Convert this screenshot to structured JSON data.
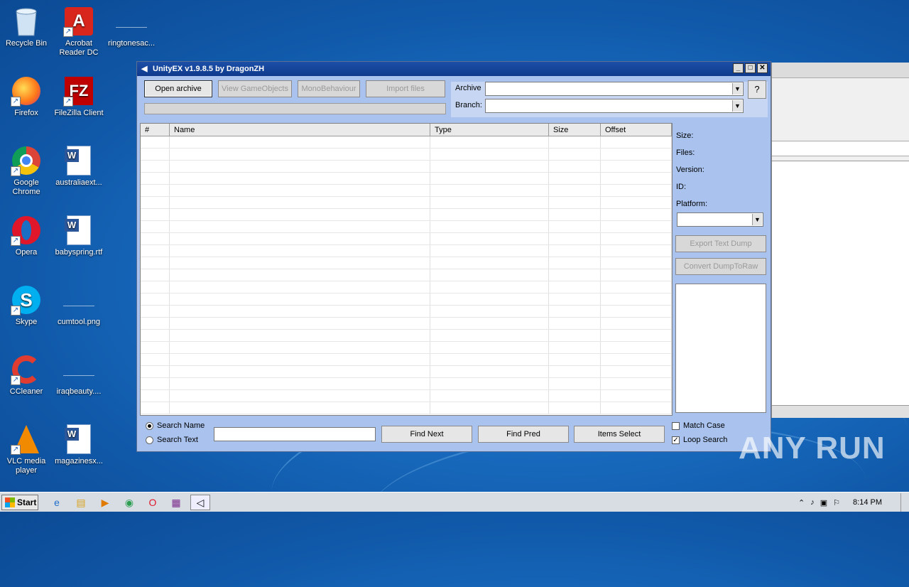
{
  "desktop_icons": [
    {
      "label": "Recycle Bin",
      "icon": "recycle-bin-icon"
    },
    {
      "label": "Acrobat Reader DC",
      "icon": "acrobat-icon"
    },
    {
      "label": "ringtonesac...",
      "icon": "file-icon"
    },
    {
      "label": "Firefox",
      "icon": "firefox-icon"
    },
    {
      "label": "FileZilla Client",
      "icon": "filezilla-icon"
    },
    {
      "label": "Google Chrome",
      "icon": "chrome-icon"
    },
    {
      "label": "australiaext...",
      "icon": "word-doc-icon"
    },
    {
      "label": "Opera",
      "icon": "opera-icon"
    },
    {
      "label": "babyspring.rtf",
      "icon": "word-doc-icon"
    },
    {
      "label": "Skype",
      "icon": "skype-icon"
    },
    {
      "label": "cumtool.png",
      "icon": "image-file-icon"
    },
    {
      "label": "CCleaner",
      "icon": "ccleaner-icon"
    },
    {
      "label": "iraqbeauty....",
      "icon": "file-icon"
    },
    {
      "label": "VLC media player",
      "icon": "vlc-icon"
    },
    {
      "label": "magazinesx...",
      "icon": "word-doc-icon"
    }
  ],
  "window": {
    "title": "UnityEX v1.9.8.5 by DragonZH",
    "toolbar": {
      "open_archive": "Open archive",
      "view_gameobjects": "View GameObjects",
      "monobehaviour": "MonoBehaviour",
      "import_files": "Import files"
    },
    "archive_label": "Archive",
    "branch_label": "Branch:",
    "help_label": "?",
    "columns": [
      "#",
      "Name",
      "Type",
      "Size",
      "Offset"
    ],
    "side": {
      "size_label": "Size:",
      "files_label": "Files:",
      "version_label": "Version:",
      "id_label": "ID:",
      "platform_label": "Platform:",
      "export_text_dump": "Export Text Dump",
      "convert_dump": "Convert DumpToRaw"
    },
    "search": {
      "search_name": "Search Name",
      "search_text": "Search Text",
      "find_next": "Find Next",
      "find_pred": "Find Pred",
      "items_select": "Items Select",
      "match_case": "Match Case",
      "loop_search": "Loop Search",
      "selected_mode": "Search Name",
      "match_case_checked": false,
      "loop_search_checked": true
    }
  },
  "taskbar": {
    "start_label": "Start",
    "clock": "8:14 PM"
  },
  "watermark": "ANY RUN"
}
